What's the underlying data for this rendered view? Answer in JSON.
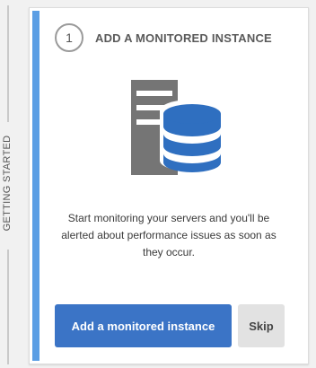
{
  "sidebar": {
    "label": "GETTING STARTED"
  },
  "card": {
    "step_number": "1",
    "title": "ADD A MONITORED INSTANCE",
    "illustration_icon": "server-database-icon",
    "description": "Start monitoring your servers and you'll be alerted about performance issues as soon as they occur.",
    "primary_button_label": "Add a monitored instance",
    "skip_button_label": "Skip"
  },
  "colors": {
    "accent": "#5b9ee4",
    "primary_button": "#3b74c6",
    "database_blue": "#2f6fc0",
    "server_gray": "#757575"
  }
}
